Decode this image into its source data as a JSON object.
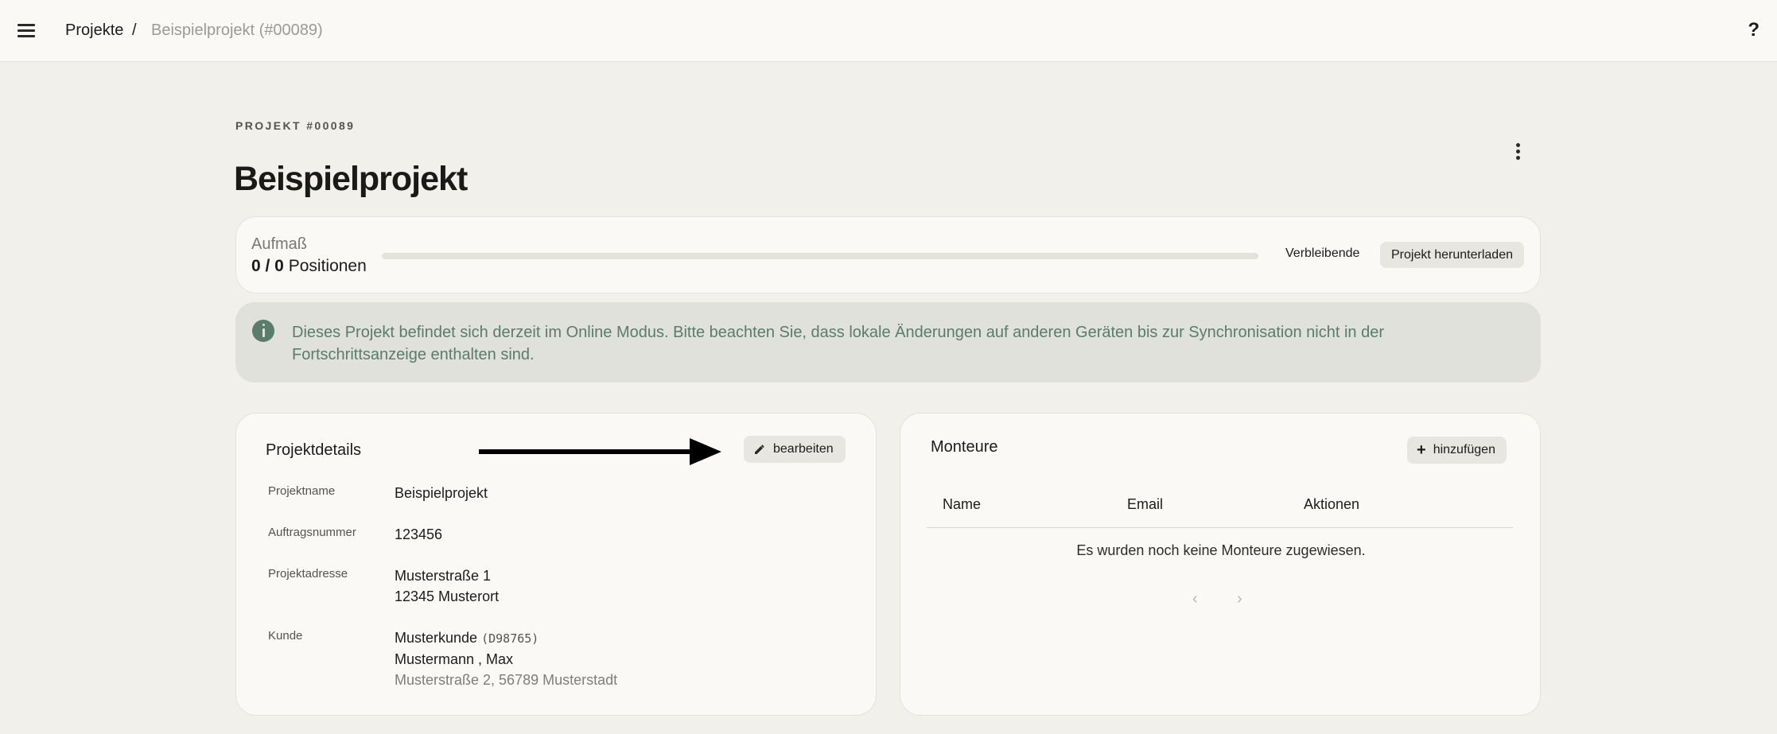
{
  "topbar": {
    "breadcrumb_root": "Projekte",
    "breadcrumb_sep": "/",
    "breadcrumb_current": "Beispielprojekt (#00089)",
    "help_label": "?"
  },
  "header": {
    "overline": "PROJEKT #00089",
    "title": "Beispielprojekt"
  },
  "progress": {
    "label": "Aufmaß",
    "count_bold": "0 / 0",
    "count_suffix": "Positionen",
    "fraction": 0,
    "remaining_label": "Verbleibende",
    "download_label": "Projekt herunterladen"
  },
  "info": {
    "text": "Dieses Projekt befindet sich derzeit im Online Modus. Bitte beachten Sie, dass lokale Änderungen auf anderen Geräten bis zur Synchronisation nicht in der Fortschrittsanzeige enthalten sind.",
    "accent": "#5b7b6b"
  },
  "details": {
    "title": "Projektdetails",
    "edit_label": "bearbeiten",
    "name_label": "Projektname",
    "name_value": "Beispielprojekt",
    "order_label": "Auftragsnummer",
    "order_value": "123456",
    "address_label": "Projektadresse",
    "address_line1": "Musterstraße 1",
    "address_line2": "12345 Musterort",
    "customer_label": "Kunde",
    "customer_name": "Musterkunde",
    "customer_id": "(D98765)",
    "customer_contact": "Mustermann , Max",
    "customer_address": "Musterstraße 2, 56789 Musterstadt"
  },
  "monteure": {
    "title": "Monteure",
    "add_label": "hinzufügen",
    "col_name": "Name",
    "col_email": "Email",
    "col_actions": "Aktionen",
    "empty_message": "Es wurden noch keine Monteure zugewiesen.",
    "prev_icon": "‹",
    "next_icon": "›"
  }
}
